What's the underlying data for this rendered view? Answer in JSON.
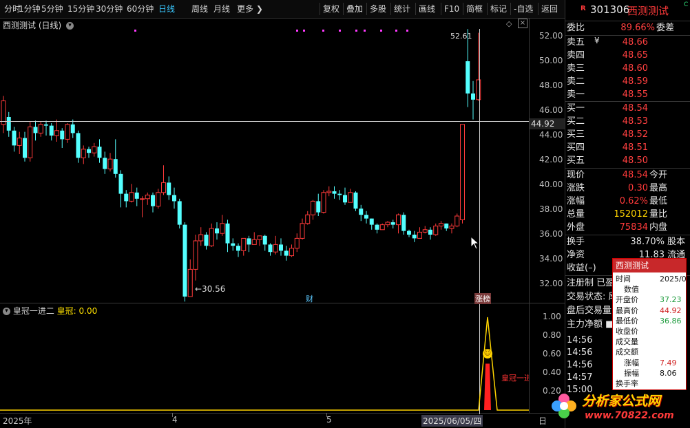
{
  "toolbar": {
    "left_items": [
      "分时",
      "1分钟",
      "5分钟",
      "15分钟",
      "30分钟",
      "60分钟",
      "日线",
      "周线",
      "月线",
      "更多 ❯"
    ],
    "active": "日线",
    "right_items": [
      "复权",
      "叠加",
      "多股",
      "统计",
      "画线",
      "F10",
      "简框",
      "标记",
      "-自选",
      "返回"
    ]
  },
  "chart": {
    "title": "西测测试 (日线)",
    "current_price_label": "44.92",
    "high_label": "52.61",
    "low_label": "←30.56",
    "marker_cai": "财",
    "marker_long": "涨榜",
    "price_ticks": [
      "52.00",
      "50.00",
      "48.00",
      "46.00",
      "44.00",
      "42.00",
      "40.00",
      "38.00",
      "36.00",
      "34.00",
      "32.00"
    ]
  },
  "indicator": {
    "name": "皇冠一进二",
    "label": "皇冠:",
    "value": "0.00",
    "ticks": [
      "1.00",
      "0.80",
      "0.60",
      "0.40",
      "0.20"
    ],
    "annotation": "皇冠一进二"
  },
  "xaxis": {
    "labels": [
      "2025年",
      "4",
      "5",
      "2025/06/05/四"
    ],
    "corner": "日"
  },
  "panel": {
    "header_badge": "R",
    "code": "301306",
    "name": "西测测试",
    "corner": "C",
    "weibi_label": "委比",
    "weibi_value": "89.66%",
    "weicha_label": "委差",
    "sell": [
      {
        "label": "卖五",
        "price": "48.66",
        "mark": "¥"
      },
      {
        "label": "卖四",
        "price": "48.65"
      },
      {
        "label": "卖三",
        "price": "48.60"
      },
      {
        "label": "卖二",
        "price": "48.59"
      },
      {
        "label": "卖一",
        "price": "48.55"
      }
    ],
    "buy": [
      {
        "label": "买一",
        "price": "48.54"
      },
      {
        "label": "买二",
        "price": "48.53"
      },
      {
        "label": "买三",
        "price": "48.52"
      },
      {
        "label": "买四",
        "price": "48.51"
      },
      {
        "label": "买五",
        "price": "48.50"
      }
    ],
    "stats": [
      {
        "k": "现价",
        "v": "48.54",
        "k2": "今开"
      },
      {
        "k": "涨跌",
        "v": "0.30",
        "k2": "最高"
      },
      {
        "k": "涨幅",
        "v": "0.62%",
        "k2": "最低"
      },
      {
        "k": "总量",
        "v": "152012",
        "k2": "量比"
      },
      {
        "k": "外盘",
        "v": "75834",
        "k2": "内盘"
      }
    ],
    "stats2": [
      {
        "k": "换手",
        "v": "38.70%",
        "k2": "股本"
      },
      {
        "k": "净资",
        "v": "11.83",
        "k2": "流通"
      },
      {
        "k": "收益(–)",
        "v": "",
        "k2": ""
      }
    ],
    "extra": [
      "注册制 已盈",
      "交易状态: 尾",
      "盘后交易量",
      "主力净额 ■"
    ],
    "times": [
      "14:56",
      "14:56",
      "14:56",
      "14:57",
      "15:00"
    ]
  },
  "tooltip": {
    "title": "西测测试",
    "rows": [
      {
        "k": "时间",
        "v": "2025/0"
      },
      {
        "k": "数值",
        "v": ""
      },
      {
        "k": "开盘价",
        "v": "37.23"
      },
      {
        "k": "最高价",
        "v": "44.92"
      },
      {
        "k": "最低价",
        "v": "36.86"
      },
      {
        "k": "收盘价",
        "v": ""
      },
      {
        "k": "成交量",
        "v": ""
      },
      {
        "k": "成交额",
        "v": ""
      },
      {
        "k": "涨幅",
        "v": "7.49"
      },
      {
        "k": "振幅",
        "v": "8.06"
      },
      {
        "k": "换手率",
        "v": ""
      }
    ]
  },
  "watermark": {
    "line1": "分析家公式网",
    "line2": "www.70822.com"
  },
  "chart_data": {
    "type": "candlestick",
    "ylim": [
      30.5,
      53.5
    ],
    "candles": [
      [
        44.9,
        46.8,
        44.2,
        47.2
      ],
      [
        45.5,
        44.4,
        43.9,
        45.9
      ],
      [
        44.4,
        43.2,
        42.7,
        44.7
      ],
      [
        43.2,
        43.8,
        42.5,
        44.3
      ],
      [
        43.8,
        42.2,
        41.9,
        44.3
      ],
      [
        42.2,
        44.7,
        41.9,
        45.1
      ],
      [
        44.7,
        44.2,
        43.6,
        45.2
      ],
      [
        44.2,
        44.9,
        43.9,
        45.1
      ],
      [
        44.9,
        44.8,
        44.0,
        45.2
      ],
      [
        44.8,
        44.0,
        43.6,
        45.0
      ],
      [
        44.0,
        44.4,
        43.5,
        45.3
      ],
      [
        44.4,
        43.7,
        43.0,
        44.6
      ],
      [
        43.7,
        44.9,
        43.4,
        45.0
      ],
      [
        44.9,
        44.2,
        43.8,
        45.3
      ],
      [
        44.2,
        42.2,
        41.8,
        44.4
      ],
      [
        42.2,
        42.9,
        41.7,
        43.2
      ],
      [
        42.9,
        42.6,
        42.2,
        43.1
      ],
      [
        42.6,
        43.1,
        42.3,
        43.4
      ],
      [
        43.1,
        42.2,
        41.8,
        43.7
      ],
      [
        42.2,
        41.3,
        40.9,
        42.7
      ],
      [
        41.3,
        42.1,
        41.1,
        42.6
      ],
      [
        42.1,
        40.9,
        40.6,
        43.7
      ],
      [
        40.9,
        39.3,
        38.2,
        41.2
      ],
      [
        39.3,
        38.7,
        38.2,
        39.6
      ],
      [
        38.7,
        39.4,
        38.6,
        40.1
      ],
      [
        39.4,
        38.9,
        38.3,
        39.8
      ],
      [
        38.9,
        38.9,
        37.4,
        39.1
      ],
      [
        38.9,
        39.2,
        38.4,
        39.4
      ],
      [
        39.2,
        38.3,
        37.8,
        39.4
      ],
      [
        38.3,
        39.4,
        38.1,
        39.7
      ],
      [
        39.4,
        40.2,
        39.2,
        41.6
      ],
      [
        40.2,
        39.2,
        38.8,
        40.7
      ],
      [
        39.2,
        38.7,
        38.1,
        39.8
      ],
      [
        38.7,
        36.8,
        36.5,
        38.9
      ],
      [
        36.8,
        31.0,
        30.6,
        37.0
      ],
      [
        31.0,
        33.2,
        31.2,
        34.0
      ],
      [
        33.2,
        35.5,
        32.3,
        36.0
      ],
      [
        35.5,
        36.0,
        35.1,
        36.6
      ],
      [
        36.0,
        35.1,
        34.8,
        36.2
      ],
      [
        35.1,
        36.5,
        35.0,
        36.9
      ],
      [
        36.5,
        36.1,
        35.6,
        37.0
      ],
      [
        36.1,
        36.9,
        35.9,
        37.6
      ],
      [
        36.9,
        35.3,
        34.6,
        37.2
      ],
      [
        35.3,
        35.1,
        34.7,
        35.7
      ],
      [
        35.1,
        34.7,
        34.2,
        35.3
      ],
      [
        34.7,
        35.7,
        34.3,
        35.7
      ],
      [
        35.7,
        35.2,
        34.6,
        35.9
      ],
      [
        35.2,
        35.6,
        35.2,
        36.2
      ],
      [
        35.6,
        35.9,
        35.1,
        35.9
      ],
      [
        35.9,
        35.2,
        34.7,
        36.0
      ],
      [
        35.2,
        34.6,
        34.3,
        35.3
      ],
      [
        34.6,
        35.2,
        34.4,
        35.9
      ],
      [
        35.2,
        34.7,
        34.3,
        35.7
      ],
      [
        34.7,
        34.3,
        33.9,
        35.1
      ],
      [
        34.3,
        34.9,
        34.2,
        35.2
      ],
      [
        34.9,
        35.7,
        34.6,
        36.1
      ],
      [
        35.7,
        36.9,
        35.6,
        37.3
      ],
      [
        36.9,
        37.6,
        36.8,
        37.9
      ],
      [
        37.6,
        38.7,
        37.2,
        38.8
      ],
      [
        38.7,
        37.8,
        37.5,
        39.3
      ],
      [
        37.8,
        39.4,
        37.7,
        39.6
      ],
      [
        39.4,
        39.5,
        39.1,
        39.9
      ],
      [
        39.5,
        39.3,
        38.9,
        39.9
      ],
      [
        39.3,
        39.2,
        38.8,
        39.6
      ],
      [
        39.2,
        38.6,
        38.4,
        39.8
      ],
      [
        38.6,
        39.4,
        38.6,
        39.7
      ],
      [
        39.4,
        38.1,
        37.9,
        39.5
      ],
      [
        38.1,
        37.6,
        37.1,
        38.4
      ],
      [
        37.6,
        37.3,
        36.9,
        37.9
      ],
      [
        37.3,
        36.8,
        36.4,
        37.3
      ],
      [
        36.8,
        36.4,
        36.1,
        36.9
      ],
      [
        36.4,
        36.8,
        36.4,
        36.9
      ],
      [
        36.8,
        37.0,
        36.6,
        37.1
      ],
      [
        37.0,
        36.8,
        36.5,
        37.2
      ],
      [
        36.8,
        37.6,
        36.1,
        37.7
      ],
      [
        37.6,
        36.3,
        36.0,
        37.8
      ],
      [
        36.3,
        36.0,
        35.8,
        36.4
      ],
      [
        36.0,
        35.7,
        35.4,
        36.3
      ],
      [
        35.7,
        36.2,
        35.7,
        36.6
      ],
      [
        36.2,
        36.4,
        36.1,
        36.7
      ],
      [
        36.4,
        36.0,
        35.6,
        36.6
      ],
      [
        36.0,
        36.7,
        35.9,
        36.9
      ],
      [
        36.7,
        36.9,
        36.4,
        37.1
      ],
      [
        36.9,
        36.5,
        36.3,
        36.9
      ],
      [
        36.5,
        36.7,
        36.1,
        36.9
      ],
      [
        36.7,
        37.5,
        36.6,
        37.7
      ],
      [
        37.2,
        44.9,
        36.9,
        44.9
      ],
      [
        50.0,
        47.4,
        46.3,
        52.6
      ],
      [
        47.4,
        46.9,
        45.3,
        48.4
      ],
      [
        46.9,
        48.5,
        46.8,
        52.3
      ]
    ]
  }
}
